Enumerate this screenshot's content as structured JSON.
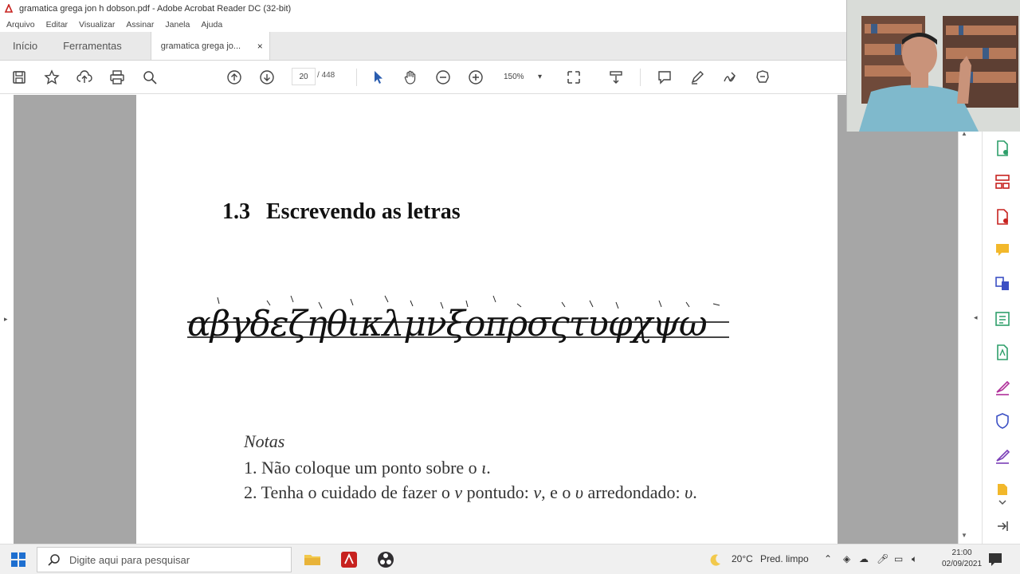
{
  "window": {
    "title": "gramatica grega jon h dobson.pdf - Adobe Acrobat Reader DC (32-bit)"
  },
  "menu": [
    "Arquivo",
    "Editar",
    "Visualizar",
    "Assinar",
    "Janela",
    "Ajuda"
  ],
  "tabs": {
    "home": "Início",
    "tools": "Ferramentas",
    "document": "gramatica grega jo...",
    "close": "×"
  },
  "toolbar": {
    "page_current": "20",
    "page_sep": "/",
    "page_total": "448",
    "zoom": "150%"
  },
  "document": {
    "section_number": "1.3",
    "section_title": "Escrevendo as letras",
    "greek_alphabet": "αβγδεζηθικλμνξοπρσςτυφχψω",
    "notes_title": "Notas",
    "note1_pre": "1. Não coloque um ponto sobre o ",
    "note1_char": "ι",
    "note1_post": ".",
    "note2_pre": "2. Tenha o cuidado de fazer o ",
    "note2_char_a": "ν",
    "note2_mid1": " pontudo: ",
    "note2_char_b": "ν",
    "note2_mid2": ", e o ",
    "note2_char_c": "υ",
    "note2_mid3": " arredondado: ",
    "note2_char_d": "υ",
    "note2_post": "."
  },
  "taskbar": {
    "search_placeholder": "Digite aqui para pesquisar",
    "weather_temp": "20°C",
    "weather_desc": "Pred. limpo",
    "time": "21:00",
    "date": "02/09/2021"
  },
  "colors": {
    "accent": "#c7221f",
    "viewer_bg": "#a6a6a6"
  }
}
